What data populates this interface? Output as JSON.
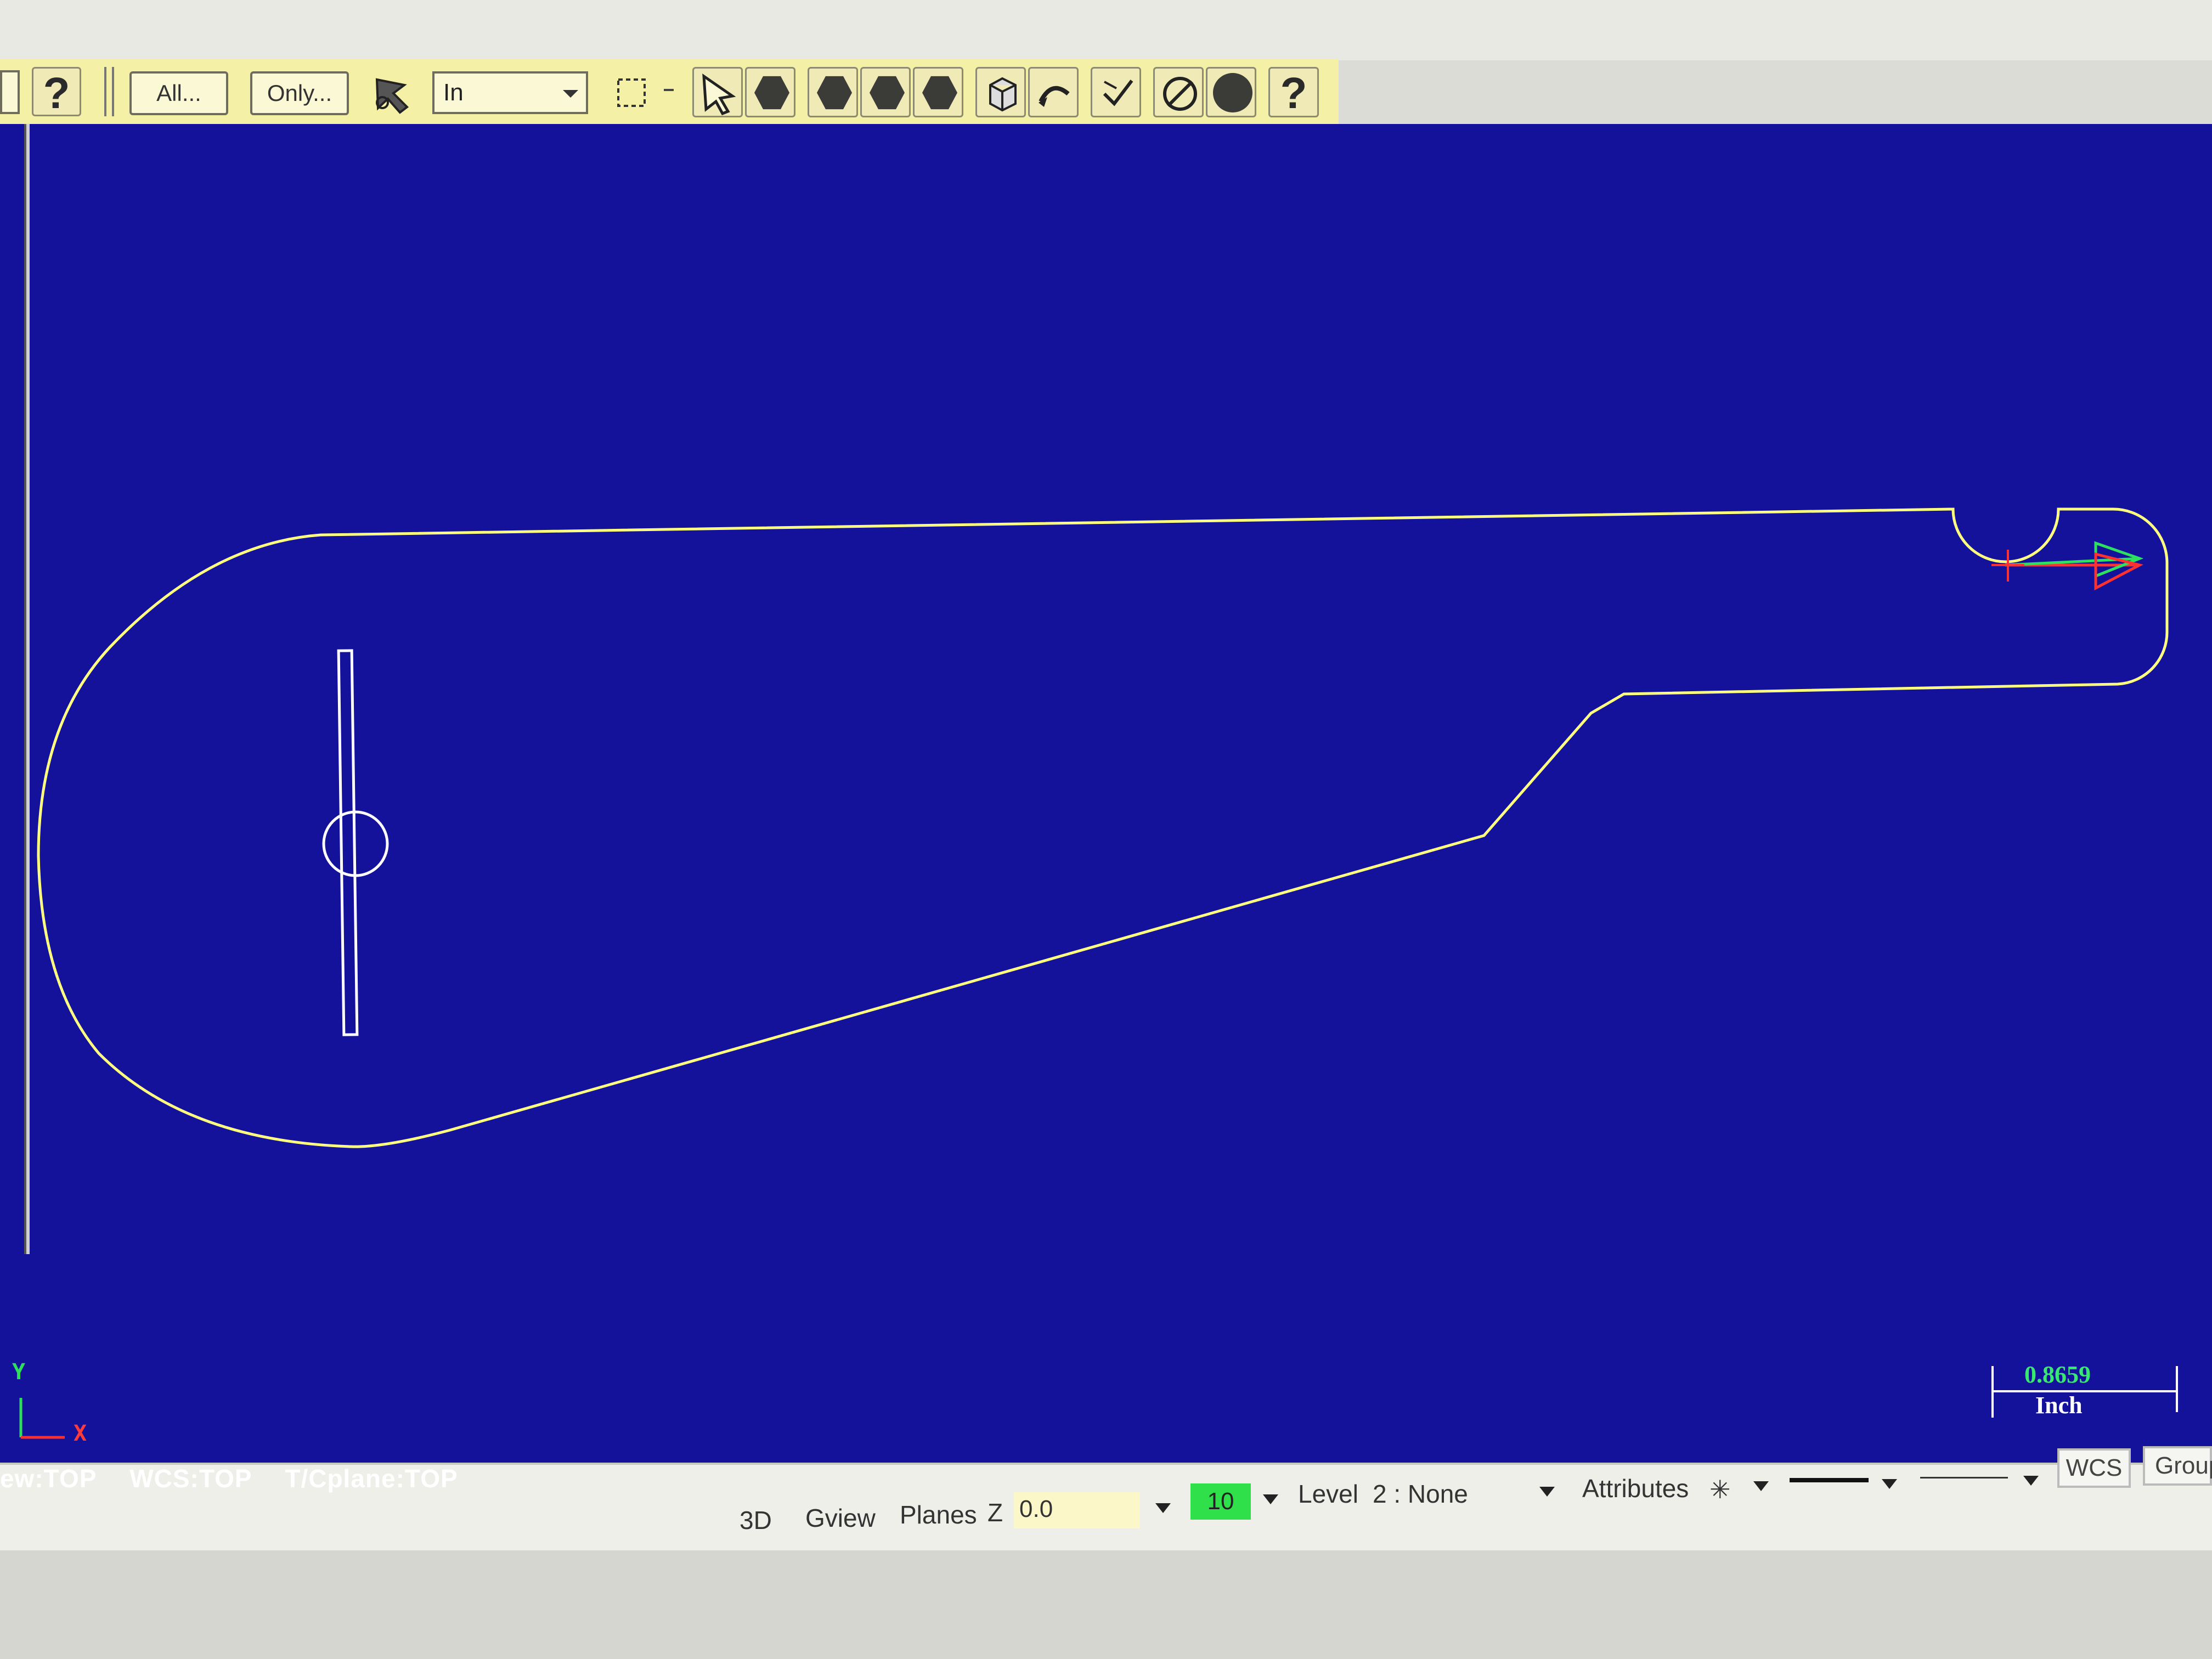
{
  "toolbar": {
    "all_label": "All...",
    "only_label": "Only...",
    "mode_select": "In",
    "help_icon": "help-question-icon",
    "icons": [
      "help-question-icon",
      "auto-cursor-icon",
      "window-select-icon",
      "cursor-arrow-icon",
      "solid-select-icon",
      "face-select-icon",
      "body-select-icon",
      "hexagon-select-icon",
      "cube-icon",
      "curve-arrow-icon",
      "verify-icon",
      "clear-selection-icon",
      "circle-solid-icon",
      "help-icon"
    ]
  },
  "viewport": {
    "background_color": "#14129a",
    "geometry_color": "#ffff80",
    "axis": {
      "y": "Y",
      "x": "X"
    },
    "status": {
      "view": "ew:TOP",
      "wcs": "WCS:TOP",
      "tplane": "T/Cplane:TOP"
    },
    "scale": {
      "value": "0.8659",
      "unit": "Inch"
    }
  },
  "status_bar": {
    "btn_3d": "3D",
    "gview": "Gview",
    "planes": "Planes",
    "z_label": "Z",
    "z_value": "0.0",
    "level_number": "10",
    "level_label": "Level",
    "level_value": "2 : None",
    "attributes": "Attributes",
    "point_style": "✳",
    "wcs": "WCS",
    "group": "Group"
  }
}
